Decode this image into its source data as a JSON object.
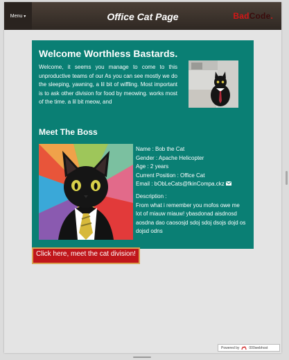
{
  "header": {
    "menu_label": "Menu",
    "title": "Office Cat Page",
    "logo_part1": "Bad",
    "logo_part2": "Code",
    "logo_dot": "."
  },
  "welcome": {
    "title": "Welcome Worthless Bastards.",
    "text": "Welcome, it seems you manage to come to this unproductive teams of our As you can see mostly we do the sleeping, yawning, a lil bit of wiffling. Most important is to ask other division for food by meowing. works most of the time. a lil bit meow, and"
  },
  "boss": {
    "title": "Meet The Boss",
    "name": "Name : Bob the Cat",
    "gender": "Gender : Apache Helicopter",
    "age": "Age : 2 years",
    "position": "Current Position : Office Cat",
    "email": "Email : bObLeCats@fkinCompa.ckz",
    "description_label": "Description :",
    "description": "From what i remember you mofos owe me lot of miauw miauw! ybasdonad aisdnosd aosdna dao caososjd sdoj sdoj dsojs dojd os dojsd odns"
  },
  "cta_label": "Click here, meet the cat division!",
  "footer": {
    "powered_by": "Powered by",
    "host": "000webhost"
  },
  "colors": {
    "panel": "#0a7f74",
    "topbar": "#3a302a",
    "cta": "#c0161b",
    "logo_red": "#d41616"
  }
}
